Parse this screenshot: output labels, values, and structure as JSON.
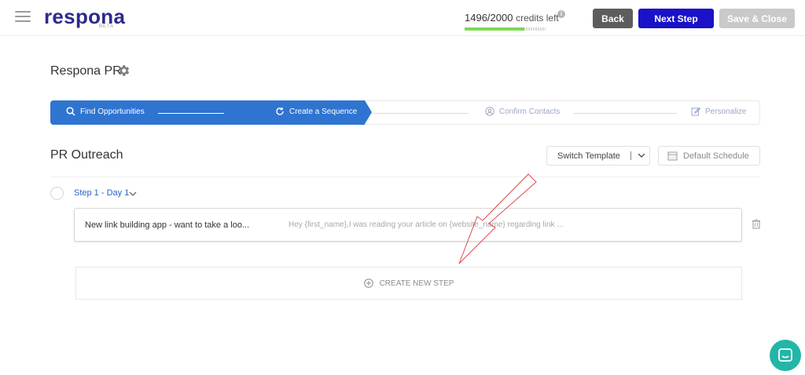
{
  "header": {
    "logo_text": "respona",
    "logo_badge": "BETA",
    "credits_used": "1496/2000",
    "credits_suffix": "credits left",
    "credits_fraction": 0.74,
    "back_label": "Back",
    "next_label": "Next Step",
    "save_label": "Save & Close"
  },
  "project": {
    "title": "Respona PR"
  },
  "stepper": {
    "steps": [
      {
        "label": "Find Opportunities",
        "icon": "search-icon",
        "state": "done"
      },
      {
        "label": "Create a Sequence",
        "icon": "refresh-icon",
        "state": "active"
      },
      {
        "label": "Confirm Contacts",
        "icon": "user-circle-icon",
        "state": "pending"
      },
      {
        "label": "Personalize",
        "icon": "edit-icon",
        "state": "pending"
      }
    ]
  },
  "sequence": {
    "title": "PR Outreach",
    "switch_template_label": "Switch Template",
    "default_schedule_label": "Default Schedule",
    "steps": [
      {
        "label": "Step 1 - Day 1",
        "subject": "New link building app - want to take a loo...",
        "preview": "Hey {first_name},I was reading your article on {website_name} regarding link ..."
      }
    ],
    "create_step_label": "CREATE NEW STEP"
  },
  "colors": {
    "brand": "#2c2a8c",
    "primary_button": "#1912c8",
    "stepper_active": "#2f74d0",
    "credits_bar": "#7ed957",
    "annotation_arrow": "#e0474c",
    "chat": "#22b6a8"
  }
}
